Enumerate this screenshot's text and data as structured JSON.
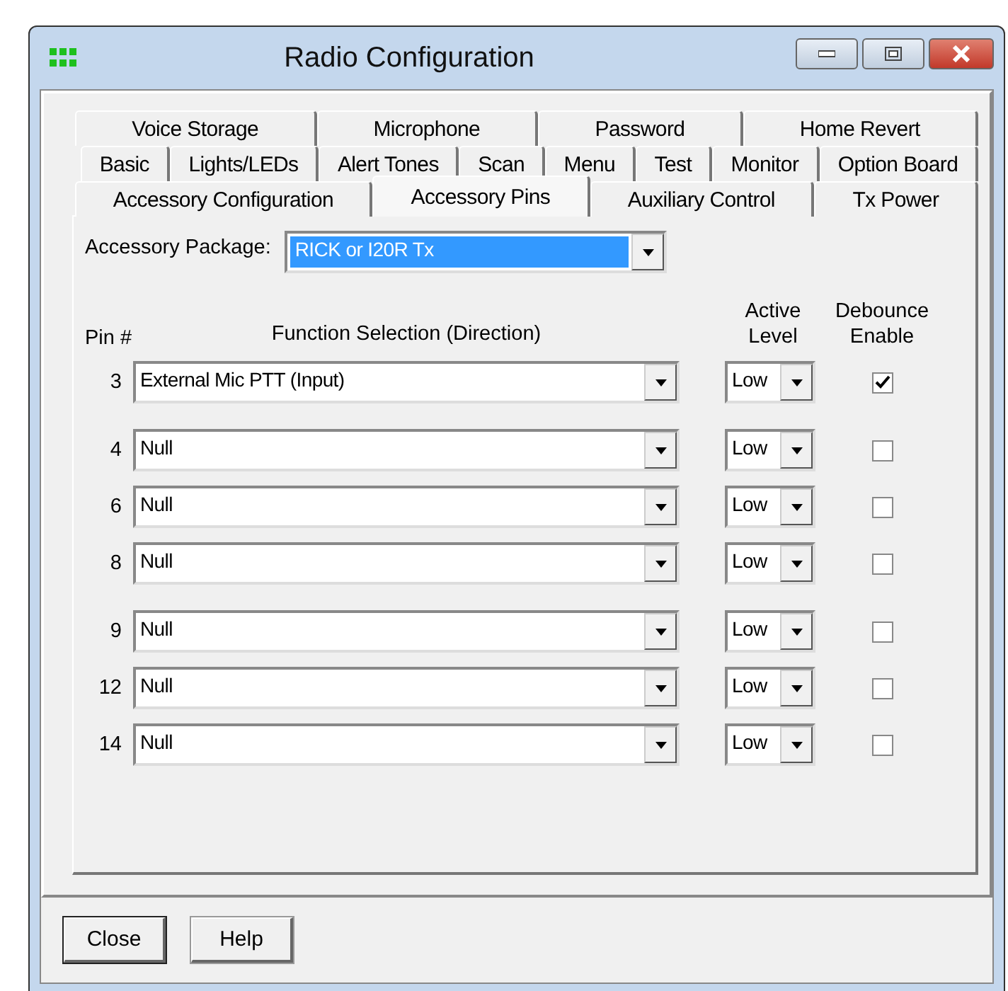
{
  "window": {
    "title": "Radio Configuration"
  },
  "tab_rows": [
    [
      {
        "label": "Voice Storage",
        "selected": false
      },
      {
        "label": "Microphone",
        "selected": false
      },
      {
        "label": "Password",
        "selected": false
      },
      {
        "label": "Home Revert",
        "selected": false
      }
    ],
    [
      {
        "label": "Basic",
        "selected": false
      },
      {
        "label": "Lights/LEDs",
        "selected": false
      },
      {
        "label": "Alert Tones",
        "selected": false
      },
      {
        "label": "Scan",
        "selected": false
      },
      {
        "label": "Menu",
        "selected": false
      },
      {
        "label": "Test",
        "selected": false
      },
      {
        "label": "Monitor",
        "selected": false
      },
      {
        "label": "Option Board",
        "selected": false
      }
    ],
    [
      {
        "label": "Accessory Configuration",
        "selected": false
      },
      {
        "label": "Accessory Pins",
        "selected": true
      },
      {
        "label": "Auxiliary Control",
        "selected": false
      },
      {
        "label": "Tx Power",
        "selected": false
      }
    ]
  ],
  "accessory_package": {
    "label": "Accessory Package:",
    "value": "RICK or I20R Tx"
  },
  "columns": {
    "pin": "Pin #",
    "function": "Function Selection (Direction)",
    "active_level": [
      "Active",
      "Level"
    ],
    "debounce": [
      "Debounce",
      "Enable"
    ]
  },
  "pins": [
    {
      "pin": "3",
      "function": "External Mic PTT (Input)",
      "active_level": "Low",
      "debounce": true
    },
    {
      "pin": "4",
      "function": "Null",
      "active_level": "Low",
      "debounce": false
    },
    {
      "pin": "6",
      "function": "Null",
      "active_level": "Low",
      "debounce": false
    },
    {
      "pin": "8",
      "function": "Null",
      "active_level": "Low",
      "debounce": false
    },
    {
      "pin": "9",
      "function": "Null",
      "active_level": "Low",
      "debounce": false
    },
    {
      "pin": "12",
      "function": "Null",
      "active_level": "Low",
      "debounce": false
    },
    {
      "pin": "14",
      "function": "Null",
      "active_level": "Low",
      "debounce": false
    }
  ],
  "buttons": [
    "Close",
    "Help"
  ]
}
